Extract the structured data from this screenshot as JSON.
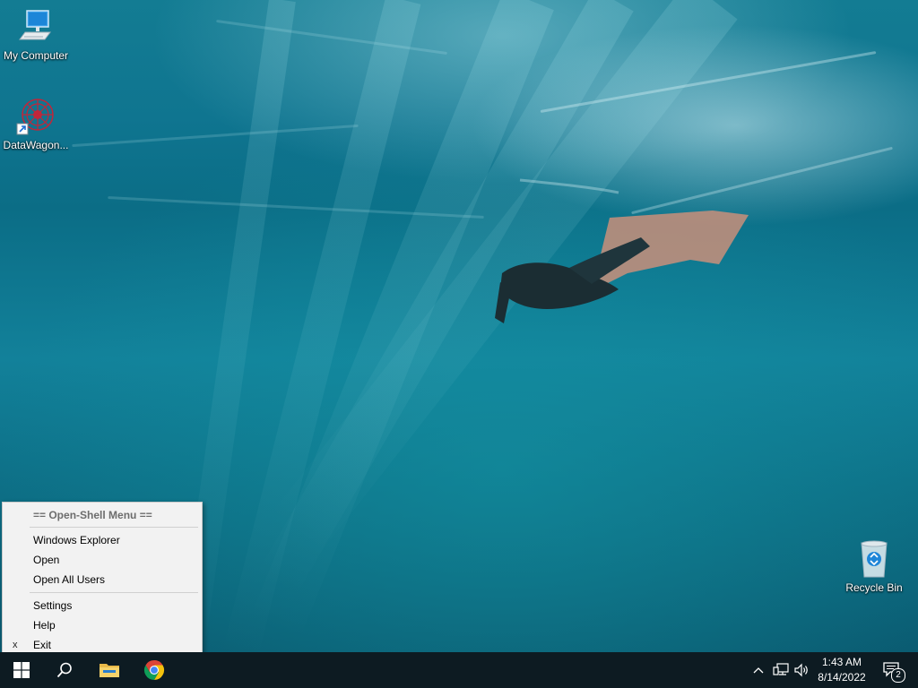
{
  "desktop": {
    "icons": [
      {
        "label": "My Computer",
        "icon": "computer-icon"
      },
      {
        "label": "DataWagon...",
        "icon": "datawagon-shortcut-icon"
      },
      {
        "label": "Recycle Bin",
        "icon": "recycle-bin-icon"
      }
    ]
  },
  "context_menu": {
    "header": "== Open-Shell Menu ==",
    "items": [
      {
        "label": "Windows Explorer"
      },
      {
        "label": "Open"
      },
      {
        "label": "Open All Users"
      },
      {
        "label": "Settings"
      },
      {
        "label": "Help"
      },
      {
        "label": "Exit",
        "marker": "x"
      }
    ]
  },
  "taskbar": {
    "buttons": [
      {
        "icon": "windows-start-icon"
      },
      {
        "icon": "search-icon"
      },
      {
        "icon": "file-explorer-icon"
      },
      {
        "icon": "chrome-icon"
      }
    ],
    "tray": {
      "icons": [
        "chevron-up-icon",
        "network-icon",
        "volume-icon"
      ],
      "time": "1:43 AM",
      "date": "8/14/2022",
      "notification_count": "2"
    }
  },
  "colors": {
    "taskbar": "#0d1b22",
    "menu_background": "#f2f2f2",
    "windows_logo": "#ffffff",
    "chrome_red": "#db4437",
    "chrome_yellow": "#f4c20d",
    "chrome_green": "#0f9d58",
    "chrome_blue": "#4285f4"
  }
}
